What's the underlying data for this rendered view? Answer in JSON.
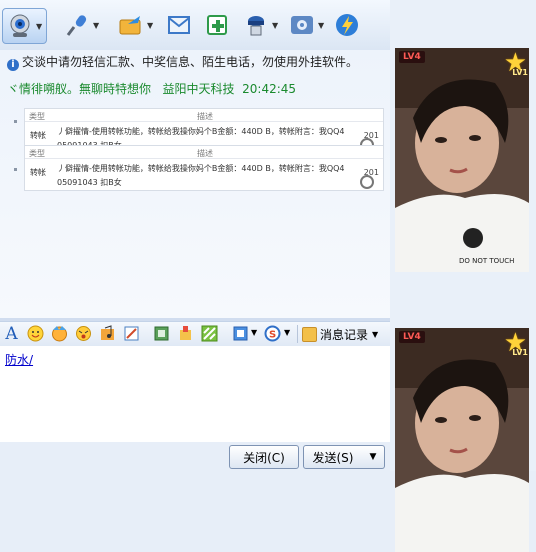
{
  "toolbar": {
    "items": [
      {
        "icon": "video-call-icon",
        "has_menu": true,
        "selected": true
      },
      {
        "icon": "voice-call-icon",
        "has_menu": true
      },
      {
        "icon": "send-file-icon",
        "has_menu": true
      },
      {
        "icon": "email-icon",
        "has_menu": false
      },
      {
        "icon": "create-group-icon",
        "has_menu": false
      },
      {
        "icon": "remote-assist-icon",
        "has_menu": true
      },
      {
        "icon": "apps-icon",
        "has_menu": true
      },
      {
        "icon": "speed-icon",
        "has_menu": false
      }
    ]
  },
  "notice": {
    "text": "交谈中请勿轻信汇款、中奖信息、陌生电话，勿使用外挂软件。"
  },
  "message": {
    "sender": "ヾ情徘嗍舣。無聊時特想你",
    "company": "益阳中天科技",
    "time": "20:42:45",
    "cards": [
      {
        "col_type": "类型",
        "col_desc": "描述",
        "type": "转帐",
        "line1": "丿僻擢情-使用转帐功能，转帐给我操你妈个B金额：440D B，转帐附言：我QQ4",
        "line2": "05091043 扣B女",
        "more": "201"
      },
      {
        "col_type": "类型",
        "col_desc": "描述",
        "type": "转帐",
        "line1": "丿僻擢情-使用转帐功能，转帐给我操你妈个B金额：440D B，转帐附言：我QQ4",
        "line2": "05091043 扣B女",
        "more": "201"
      }
    ]
  },
  "input_toolbar": {
    "icons": [
      "font-icon",
      "emoticon-icon",
      "magic-face-icon",
      "shake-icon",
      "music-icon",
      "doodle-icon",
      "screenshot-icon",
      "image-icon",
      "sticker-icon",
      "gift-icon",
      "search-icon"
    ],
    "record_label": "消息记录"
  },
  "input": {
    "text": "防水/"
  },
  "buttons": {
    "close": "关闭(C)",
    "send": "发送(S)"
  },
  "right_panel": {
    "badges": [
      {
        "level": "LV4",
        "star_level": "LV1"
      },
      {
        "level": "LV4",
        "star_level": "LV1"
      }
    ],
    "shirt_text": "DO NOT TOUCH"
  },
  "colors": {
    "sender_green": "#1a8a2e",
    "link_blue": "#0000cc",
    "level_red": "#ff5a55"
  }
}
